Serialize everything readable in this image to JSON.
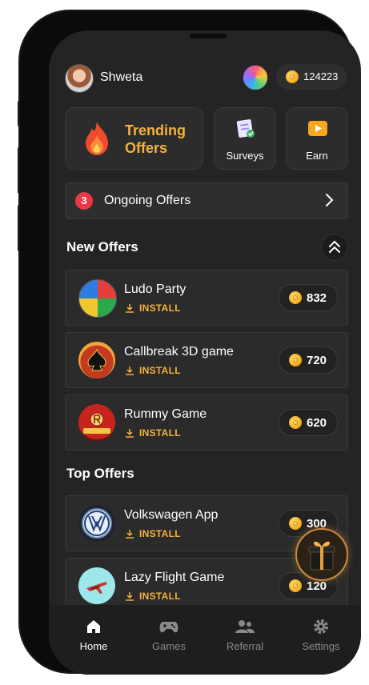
{
  "user": {
    "name": "Shweta",
    "coins": "124223"
  },
  "quick": {
    "trending": "Trending Offers",
    "surveys": "Surveys",
    "earn": "Earn"
  },
  "ongoing": {
    "count": "3",
    "label": "Ongoing Offers"
  },
  "new_offers": {
    "title": "New Offers",
    "items": [
      {
        "name": "Ludo Party",
        "action": "INSTALL",
        "coins": "832"
      },
      {
        "name": "Callbreak 3D game",
        "action": "INSTALL",
        "coins": "720"
      },
      {
        "name": "Rummy Game",
        "action": "INSTALL",
        "coins": "620"
      }
    ]
  },
  "top_offers": {
    "title": "Top Offers",
    "items": [
      {
        "name": "Volkswagen App",
        "action": "INSTALL",
        "coins": "300"
      },
      {
        "name": "Lazy Flight Game",
        "action": "INSTALL",
        "coins": "120"
      }
    ]
  },
  "nav": {
    "home": "Home",
    "games": "Games",
    "referral": "Referral",
    "settings": "Settings"
  },
  "colors": {
    "accent": "#f5b33b",
    "badge": "#ea3847",
    "background": "#242424"
  }
}
